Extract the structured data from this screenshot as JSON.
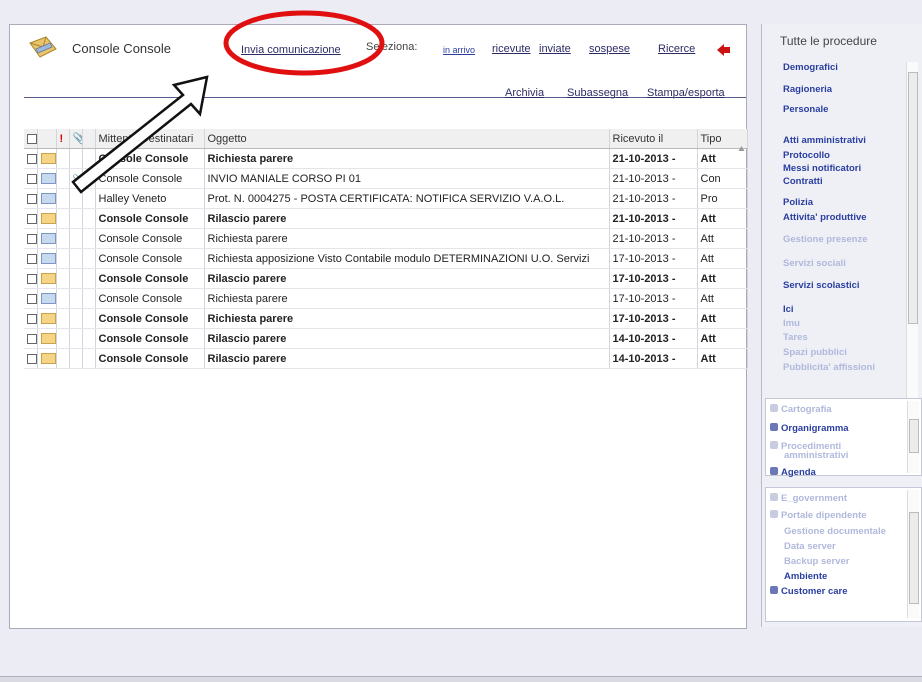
{
  "header": {
    "app_title": "Console Console",
    "send_link": "Invia comunicazione",
    "select_label": "Seleziona:",
    "filters": [
      "in arrivo",
      "ricevute",
      "inviate",
      "sospese"
    ],
    "search_link": "Ricerce"
  },
  "actions": [
    "Archivia",
    "Subassegna",
    "Stampa/esporta"
  ],
  "table": {
    "columns": [
      "Mittente/Destinatari",
      "Oggetto",
      "Ricevuto il",
      "Tipo"
    ],
    "rows": [
      {
        "sender": "Console Console",
        "subject": "Richiesta parere",
        "date": "21-10-2013 -",
        "type": "Att",
        "bold": true,
        "icon": "envelope-closed",
        "attach": false
      },
      {
        "sender": "Console Console",
        "subject": "INVIO MANIALE CORSO PI 01",
        "date": "21-10-2013 -",
        "type": "Con",
        "bold": false,
        "icon": "envelope-open",
        "attach": true
      },
      {
        "sender": "Halley Veneto",
        "subject": "Prot. N. 0004275 - POSTA CERTIFICATA: NOTIFICA SERVIZIO V.A.O.L.",
        "date": "21-10-2013 -",
        "type": "Pro",
        "bold": false,
        "icon": "envelope-open",
        "attach": false
      },
      {
        "sender": "Console Console",
        "subject": "Rilascio parere",
        "date": "21-10-2013 -",
        "type": "Att",
        "bold": true,
        "icon": "envelope-closed",
        "attach": false
      },
      {
        "sender": "Console Console",
        "subject": "Richiesta parere",
        "date": "21-10-2013 -",
        "type": "Att",
        "bold": false,
        "icon": "envelope-open",
        "attach": false
      },
      {
        "sender": "Console Console",
        "subject": "Richiesta apposizione Visto Contabile modulo DETERMINAZIONI U.O. Servizi",
        "date": "17-10-2013 -",
        "type": "Att",
        "bold": false,
        "icon": "envelope-open",
        "attach": false
      },
      {
        "sender": "Console Console",
        "subject": "Rilascio parere",
        "date": "17-10-2013 -",
        "type": "Att",
        "bold": true,
        "icon": "envelope-closed",
        "attach": false
      },
      {
        "sender": "Console Console",
        "subject": "Richiesta parere",
        "date": "17-10-2013 -",
        "type": "Att",
        "bold": false,
        "icon": "envelope-open",
        "attach": false
      },
      {
        "sender": "Console Console",
        "subject": "Richiesta parere",
        "date": "17-10-2013 -",
        "type": "Att",
        "bold": true,
        "icon": "envelope-closed",
        "attach": false
      },
      {
        "sender": "Console Console",
        "subject": "Rilascio parere",
        "date": "14-10-2013 -",
        "type": "Att",
        "bold": true,
        "icon": "envelope-closed",
        "attach": false
      },
      {
        "sender": "Console Console",
        "subject": "Rilascio parere",
        "date": "14-10-2013 -",
        "type": "Att",
        "bold": true,
        "icon": "envelope-closed",
        "attach": false
      }
    ]
  },
  "sidebar": {
    "title": "Tutte le procedure",
    "procedures": [
      {
        "label": "Demografici",
        "enabled": true
      },
      {
        "label": "Ragioneria",
        "enabled": true
      },
      {
        "label": "Personale",
        "enabled": true
      },
      {
        "label": "Atti amministrativi",
        "enabled": true
      },
      {
        "label": "Protocollo",
        "enabled": true
      },
      {
        "label": "Messi notificatori",
        "enabled": true
      },
      {
        "label": "Contratti",
        "enabled": true
      },
      {
        "label": "Polizia",
        "enabled": true
      },
      {
        "label": "Attivita' produttive",
        "enabled": true
      },
      {
        "label": "Gestione presenze",
        "enabled": false
      },
      {
        "label": "Servizi sociali",
        "enabled": false
      },
      {
        "label": "Servizi scolastici",
        "enabled": true
      },
      {
        "label": "Ici",
        "enabled": true
      },
      {
        "label": "Imu",
        "enabled": false
      },
      {
        "label": "Tares",
        "enabled": false
      },
      {
        "label": "Spazi pubblici",
        "enabled": false
      },
      {
        "label": "Pubblicita' affissioni",
        "enabled": false
      }
    ],
    "section2": [
      {
        "label": "Cartografia",
        "enabled": false,
        "icon": "globe-icon"
      },
      {
        "label": "Organigramma",
        "enabled": true,
        "icon": "org-chart-icon"
      },
      {
        "label": "Procedimenti",
        "enabled": false,
        "icon": "books-icon"
      },
      {
        "label": "amministrativi",
        "enabled": false,
        "icon": ""
      },
      {
        "label": "Agenda",
        "enabled": true,
        "icon": "calendar-icon"
      }
    ],
    "section3": [
      {
        "label": "E_government",
        "enabled": false,
        "icon": "globe-icon"
      },
      {
        "label": "Portale dipendente",
        "enabled": false,
        "icon": "pin-icon"
      },
      {
        "label": "Gestione documentale",
        "enabled": false,
        "icon": ""
      },
      {
        "label": "Data server",
        "enabled": false,
        "icon": ""
      },
      {
        "label": "Backup server",
        "enabled": false,
        "icon": ""
      },
      {
        "label": "Ambiente",
        "enabled": true,
        "icon": ""
      },
      {
        "label": "Customer care",
        "enabled": true,
        "icon": "headset-icon"
      }
    ]
  },
  "colors": {
    "annotation": "#e01010",
    "link": "#2c2c66",
    "link_active": "#2a3ea0",
    "link_disabled": "#b0b8dc",
    "back_arrow": "#cc1111"
  }
}
